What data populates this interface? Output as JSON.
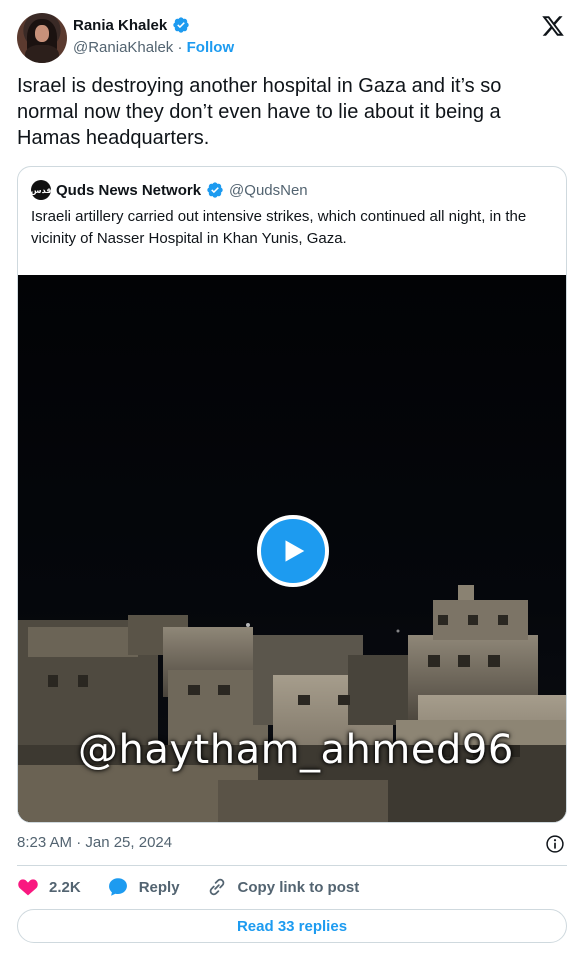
{
  "author": {
    "name": "Rania Khalek",
    "handle": "@RaniaKhalek",
    "separator": "·",
    "follow_label": "Follow"
  },
  "tweet": {
    "text": "Israel is destroying another hospital in Gaza and it’s so normal now they don’t even have to lie about it being a Hamas headquarters.",
    "timestamp": "8:23 AM · Jan 25, 2024"
  },
  "quote": {
    "avatar_text": "قدس",
    "name": "Quds News Network",
    "handle": "@QudsNen",
    "text": "Israeli artillery carried out intensive strikes, which continued all night, in the vicinity of Nasser Hospital in Khan Yunis, Gaza.",
    "video_watermark": "@haytham_ahmed96"
  },
  "actions": {
    "like_count": "2.2K",
    "reply_label": "Reply",
    "copy_link_label": "Copy link to post"
  },
  "read_replies_label": "Read 33 replies",
  "colors": {
    "accent": "#1d9bf0",
    "like": "#f91880",
    "text": "#0f1419",
    "muted": "#536471",
    "border": "#cfd9de"
  },
  "icons": [
    "verified-badge-icon",
    "x-logo-icon",
    "play-icon",
    "info-icon",
    "heart-icon",
    "reply-bubble-icon",
    "link-icon"
  ]
}
